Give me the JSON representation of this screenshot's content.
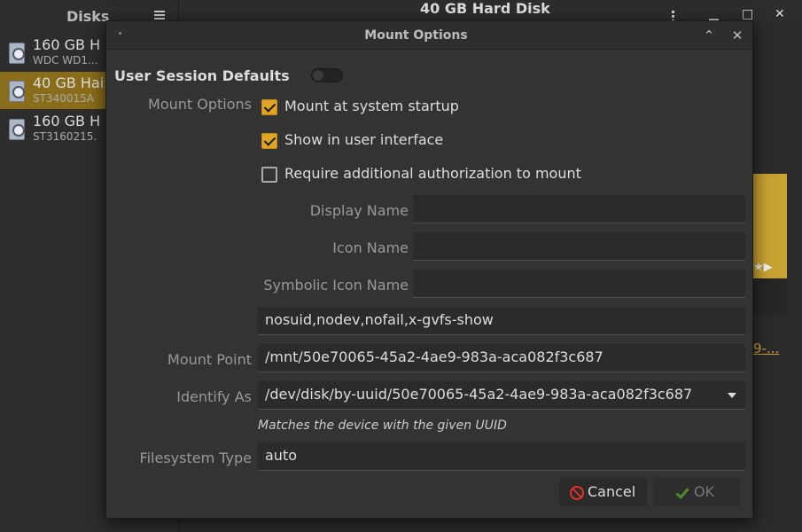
{
  "background": {
    "sidebar_title": "Disks",
    "disks": [
      {
        "name": "160 GB H",
        "model": "WDC WD1..."
      },
      {
        "name": "40 GB Hai",
        "model": "ST340015A"
      },
      {
        "name": "160 GB H",
        "model": "ST3160215."
      }
    ],
    "main_title": "40 GB Hard Disk",
    "link_text": "9-..."
  },
  "dialog": {
    "title": "Mount Options",
    "user_session_defaults_label": "User Session Defaults",
    "user_session_defaults_on": false,
    "mount_options_label": "Mount Options",
    "checkboxes": [
      {
        "label": "Mount at system startup",
        "checked": true
      },
      {
        "label": "Show in user interface",
        "checked": true
      },
      {
        "label": "Require additional authorization to mount",
        "checked": false
      }
    ],
    "display_name_label": "Display Name",
    "display_name_value": "",
    "icon_name_label": "Icon Name",
    "icon_name_value": "",
    "symbolic_icon_name_label": "Symbolic Icon Name",
    "symbolic_icon_name_value": "",
    "options_value": "nosuid,nodev,nofail,x-gvfs-show",
    "mount_point_label": "Mount Point",
    "mount_point_value": "/mnt/50e70065-45a2-4ae9-983a-aca082f3c687",
    "identify_as_label": "Identify As",
    "identify_as_value": "/dev/disk/by-uuid/50e70065-45a2-4ae9-983a-aca082f3c687",
    "identify_hint": "Matches the device with the given UUID",
    "filesystem_type_label": "Filesystem Type",
    "filesystem_type_value": "auto",
    "cancel_label": "Cancel",
    "ok_label": "OK"
  },
  "colors": {
    "accent": "#e0a526",
    "selection": "#8a6d1a",
    "cancel_icon": "#e0302d",
    "ok_icon": "#4c8a2a"
  }
}
